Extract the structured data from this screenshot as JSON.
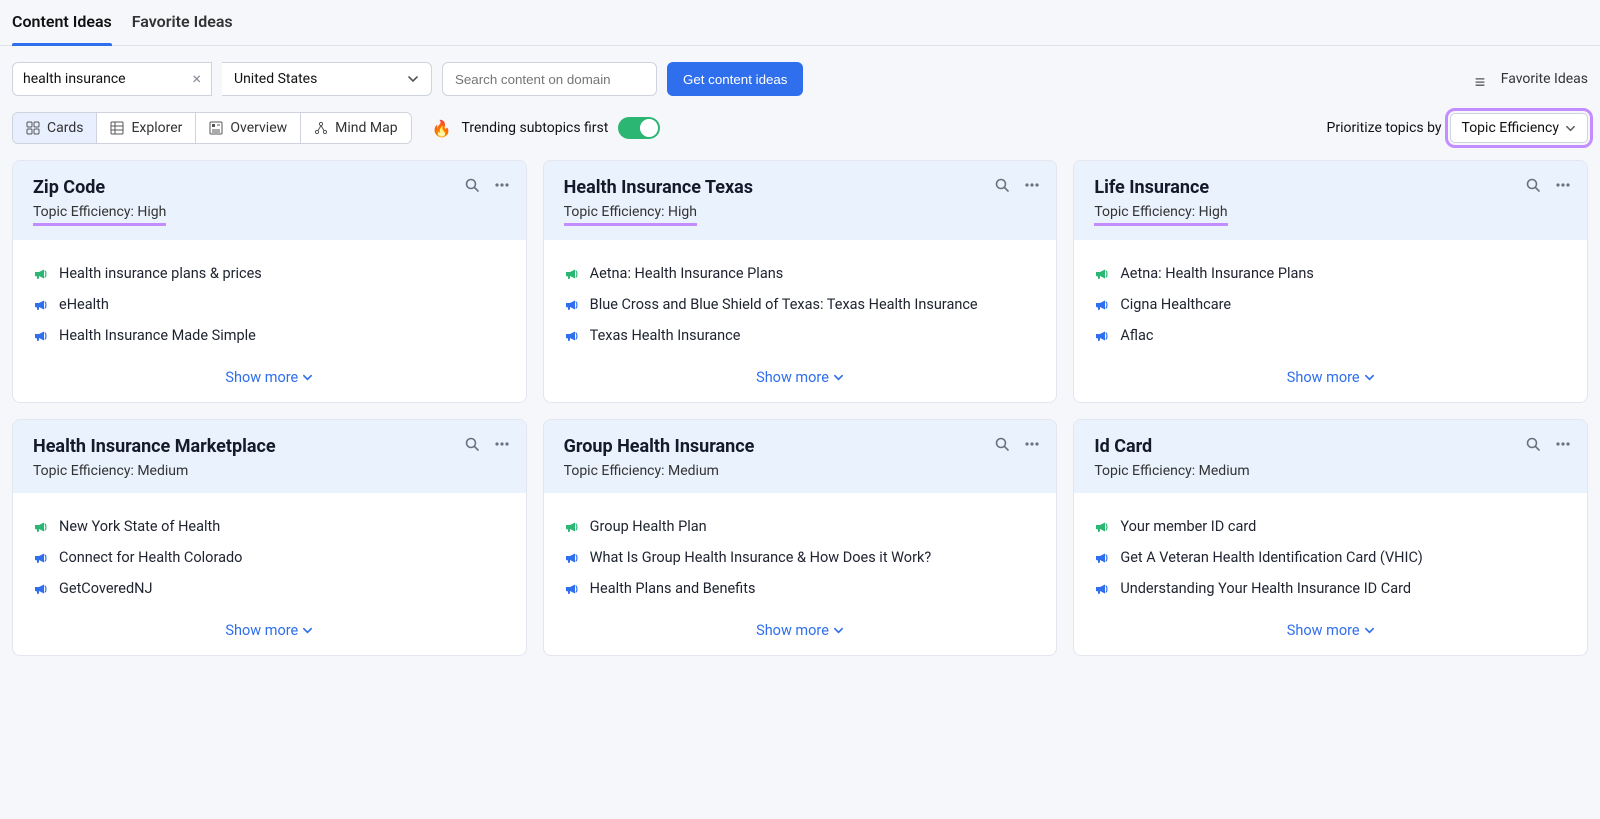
{
  "tabs": {
    "content_ideas": "Content Ideas",
    "favorite_ideas": "Favorite Ideas"
  },
  "toolbar": {
    "keyword": "health insurance",
    "country": "United States",
    "domain_placeholder": "Search content on domain",
    "get_ideas": "Get content ideas",
    "favorite_ideas_link": "Favorite Ideas"
  },
  "views": {
    "cards": "Cards",
    "explorer": "Explorer",
    "overview": "Overview",
    "mindmap": "Mind Map"
  },
  "trending": {
    "label": "Trending subtopics first",
    "on": true
  },
  "prioritize": {
    "label": "Prioritize topics by",
    "value": "Topic Efficiency"
  },
  "show_more": "Show more",
  "efficiency_label": "Topic Efficiency:",
  "cards": [
    {
      "title": "Zip Code",
      "efficiency": "High",
      "items": [
        {
          "text": "Health insurance plans & prices",
          "kind": "green"
        },
        {
          "text": "eHealth",
          "kind": "blue"
        },
        {
          "text": "Health Insurance Made Simple",
          "kind": "blue"
        }
      ]
    },
    {
      "title": "Health Insurance Texas",
      "efficiency": "High",
      "items": [
        {
          "text": "Aetna: Health Insurance Plans",
          "kind": "green"
        },
        {
          "text": "Blue Cross and Blue Shield of Texas: Texas Health Insurance",
          "kind": "blue"
        },
        {
          "text": "Texas Health Insurance",
          "kind": "blue"
        }
      ]
    },
    {
      "title": "Life Insurance",
      "efficiency": "High",
      "items": [
        {
          "text": "Aetna: Health Insurance Plans",
          "kind": "green"
        },
        {
          "text": "Cigna Healthcare",
          "kind": "blue"
        },
        {
          "text": "Aflac",
          "kind": "blue"
        }
      ]
    },
    {
      "title": "Health Insurance Marketplace",
      "efficiency": "Medium",
      "items": [
        {
          "text": "New York State of Health",
          "kind": "green"
        },
        {
          "text": "Connect for Health Colorado",
          "kind": "blue"
        },
        {
          "text": "GetCoveredNJ",
          "kind": "blue"
        }
      ]
    },
    {
      "title": "Group Health Insurance",
      "efficiency": "Medium",
      "items": [
        {
          "text": "Group Health Plan",
          "kind": "green"
        },
        {
          "text": "What Is Group Health Insurance & How Does it Work?",
          "kind": "blue"
        },
        {
          "text": "Health Plans and Benefits",
          "kind": "blue"
        }
      ]
    },
    {
      "title": "Id Card",
      "efficiency": "Medium",
      "items": [
        {
          "text": "Your member ID card",
          "kind": "green"
        },
        {
          "text": "Get A Veteran Health Identification Card (VHIC)",
          "kind": "blue"
        },
        {
          "text": "Understanding Your Health Insurance ID Card",
          "kind": "blue"
        }
      ]
    }
  ]
}
